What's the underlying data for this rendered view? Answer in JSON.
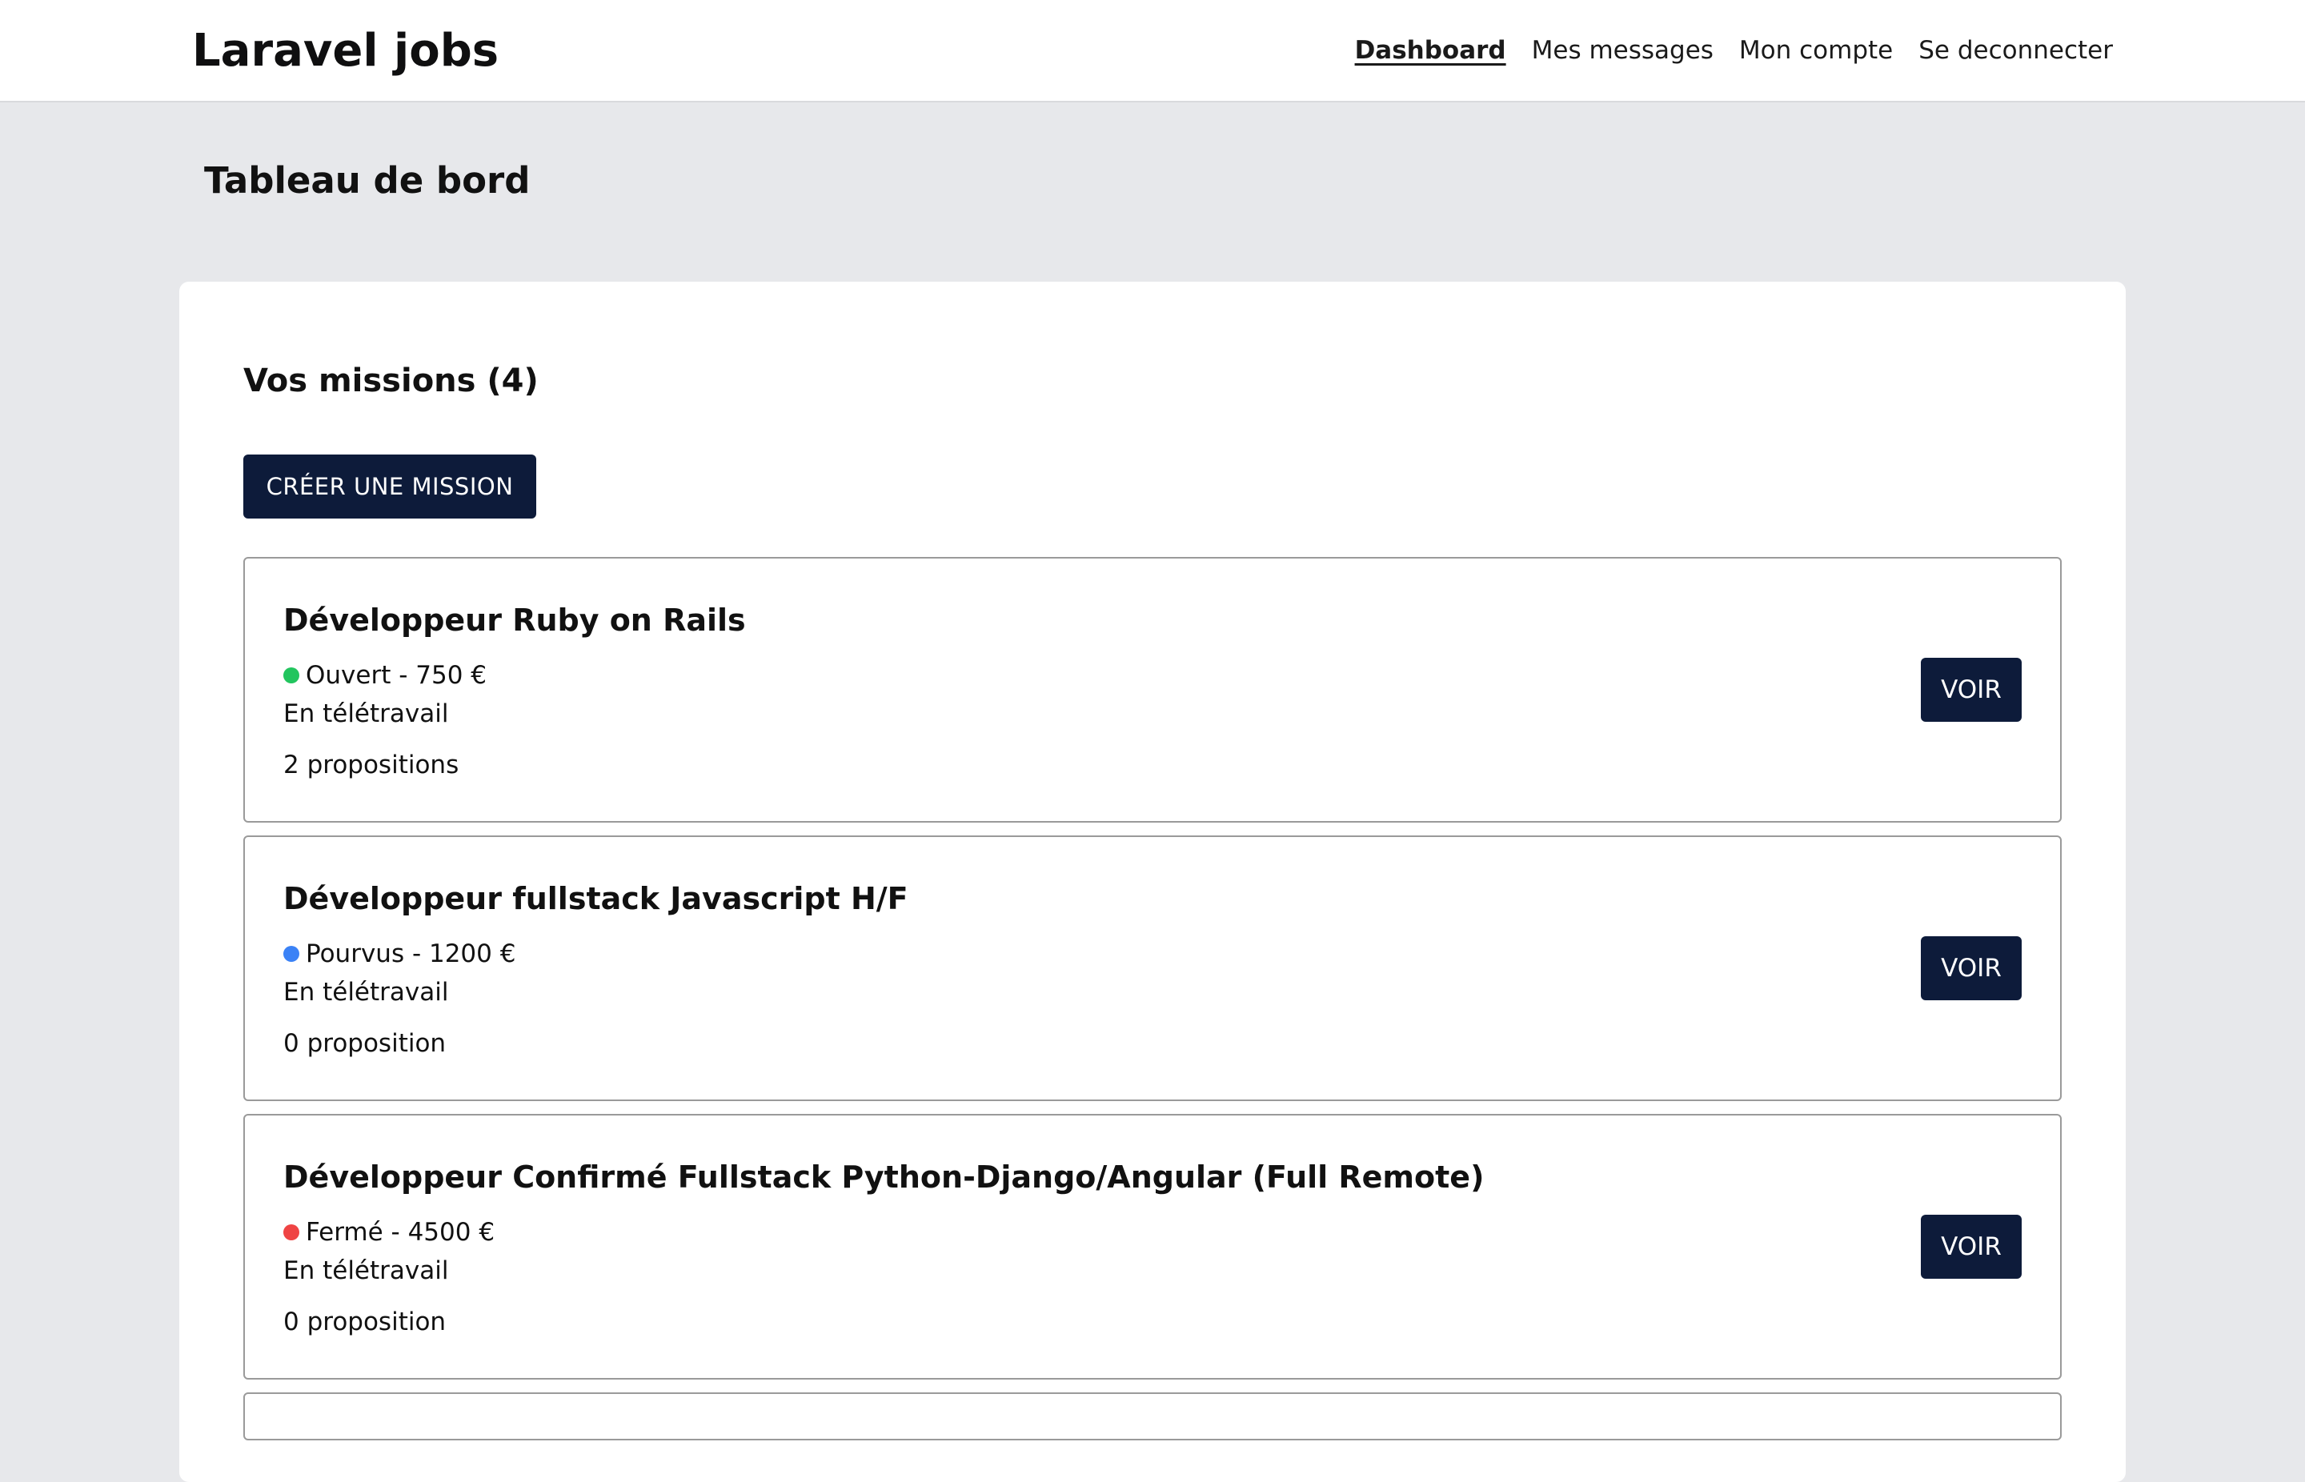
{
  "header": {
    "brand": "Laravel jobs",
    "nav": [
      {
        "label": "Dashboard",
        "active": true
      },
      {
        "label": "Mes messages",
        "active": false
      },
      {
        "label": "Mon compte",
        "active": false
      },
      {
        "label": "Se deconnecter",
        "active": false
      }
    ]
  },
  "page": {
    "title": "Tableau de bord"
  },
  "missions_section": {
    "title": "Vos missions (4)",
    "create_label": "CRÉER UNE MISSION",
    "items": [
      {
        "title": "Développeur Ruby on Rails",
        "status": "Ouvert - 750 €",
        "status_color": "#22c55e",
        "location": "En télétravail",
        "proposals": "2 propositions",
        "action_label": "VOIR"
      },
      {
        "title": "Développeur fullstack Javascript H/F",
        "status": "Pourvus - 1200 €",
        "status_color": "#3b82f6",
        "location": "En télétravail",
        "proposals": "0 proposition",
        "action_label": "VOIR"
      },
      {
        "title": "Développeur Confirmé Fullstack Python-Django/Angular (Full Remote)",
        "status": "Fermé - 4500 €",
        "status_color": "#ef4444",
        "location": "En télétravail",
        "proposals": "0 proposition",
        "action_label": "VOIR"
      }
    ]
  },
  "colors": {
    "primary_button": "#0d1b3a",
    "page_background": "#e7e8eb"
  }
}
